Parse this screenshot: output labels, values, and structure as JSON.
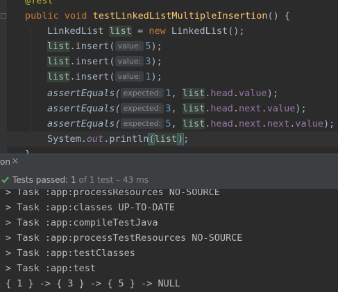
{
  "editor": {
    "annotation": "@Test",
    "kw_public": "public",
    "kw_void": "void",
    "method_name": "testLinkedListMultipleInsertion",
    "sig_tail": "() {",
    "l2_type": "LinkedList",
    "l2_var": "list",
    "l2_eq": " = ",
    "l2_new": "new",
    "l2_ctor": " LinkedList();",
    "insert_var": "list",
    "insert_call": ".insert(",
    "insert_hint": "value:",
    "insert_values": [
      "5",
      "3",
      "1"
    ],
    "close_paren": ");",
    "assert_fn": "assertEquals(",
    "assert_hint": "expected:",
    "assert_expected": [
      "1",
      "3",
      "5"
    ],
    "comma": ", ",
    "list_var": "list",
    "dot": ".",
    "field_head": "head",
    "field_next": "next",
    "field_value": "value",
    "print_system": "System.",
    "print_out": "out",
    "print_method": ".println",
    "print_open": "(",
    "print_arg": "list",
    "print_close": ")",
    "print_semi": ";",
    "closing_brace": "}"
  },
  "run_panel": {
    "tab_label": "on",
    "close_glyph": "×",
    "status_prefix": "Tests passed: ",
    "passed_count": "1",
    "status_suffix": " of 1 test – 43 ms"
  },
  "console": {
    "lines": [
      "> Task :app:processResources NO-SOURCE",
      "> Task :app:classes UP-TO-DATE",
      "> Task :app:compileTestJava",
      "> Task :app:processTestResources NO-SOURCE",
      "> Task :app:testClasses",
      "> Task :app:test",
      "{ 1 } -> { 3 } -> { 5 } -> NULL"
    ]
  },
  "colors": {
    "editor_bg": "#2b2b2b",
    "keyword": "#cc7832",
    "method": "#ffc66d",
    "number": "#6897bb",
    "field": "#9876aa",
    "pass_green": "#5fb865"
  }
}
